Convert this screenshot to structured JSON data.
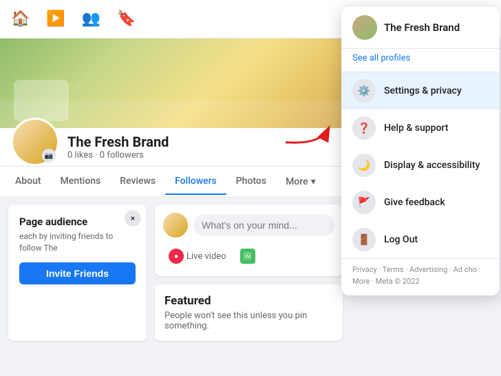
{
  "nav": {
    "icons": [
      "home",
      "video",
      "people",
      "bookmark"
    ],
    "grid_label": "⊞",
    "avatar_alt": "user avatar"
  },
  "profile": {
    "name": "The Fresh Brand",
    "stats": "0 likes · 0 followers",
    "camera_icon": "📷"
  },
  "tabs": [
    {
      "label": "About",
      "active": false
    },
    {
      "label": "Mentions",
      "active": false
    },
    {
      "label": "Reviews",
      "active": false
    },
    {
      "label": "Followers",
      "active": false
    },
    {
      "label": "Photos",
      "active": false
    },
    {
      "label": "More",
      "active": false
    }
  ],
  "audience_card": {
    "title": "Page audience",
    "desc": "each by inviting friends to follow The",
    "button": "Invite Friends",
    "close": "×"
  },
  "post_box": {
    "placeholder": "What's on your mind...",
    "live_label": "Live video",
    "photo_label": "Photo"
  },
  "featured": {
    "title": "Featured",
    "desc": "People won't see this unless you pin something."
  },
  "dropdown": {
    "profile_name": "The Fresh Brand",
    "see_all": "See all profiles",
    "items": [
      {
        "icon": "⚙️",
        "label": "Settings & privacy",
        "active": true
      },
      {
        "icon": "❓",
        "label": "Help & support",
        "active": false
      },
      {
        "icon": "🌙",
        "label": "Display & accessibility",
        "active": false
      },
      {
        "icon": "🚩",
        "label": "Give feedback",
        "active": false
      },
      {
        "icon": "🚪",
        "label": "Log Out",
        "active": false
      }
    ],
    "footer": "Privacy · Terms · Advertising · Ad cho · More · Meta © 2022"
  }
}
